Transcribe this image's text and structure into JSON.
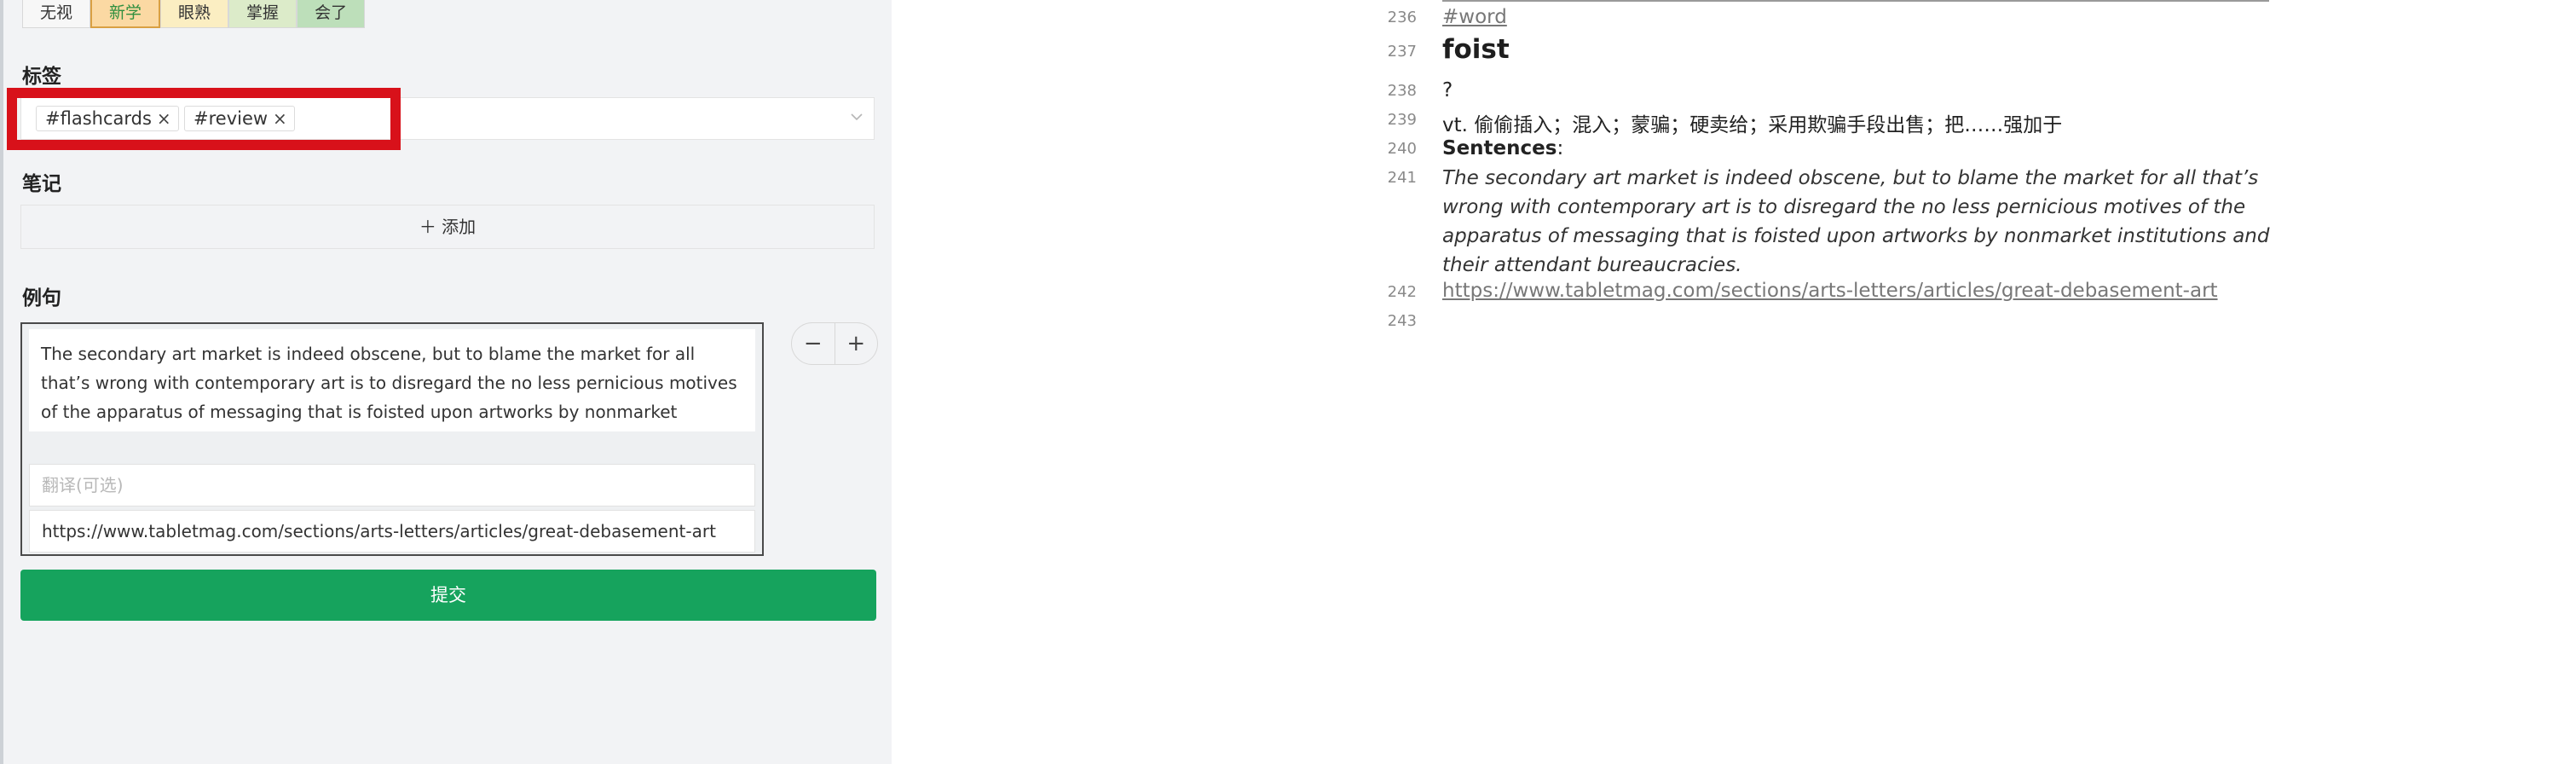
{
  "status_buttons": [
    {
      "label": "无视"
    },
    {
      "label": "新学"
    },
    {
      "label": "眼熟"
    },
    {
      "label": "掌握"
    },
    {
      "label": "会了"
    }
  ],
  "tags_section": {
    "label": "标签",
    "tags": [
      "#flashcards",
      "#review"
    ]
  },
  "notes_section": {
    "label": "笔记",
    "add_label": "添加"
  },
  "examples_section": {
    "label": "例句",
    "sentence": "The secondary art market is indeed obscene, but to blame the market for all that’s wrong with contemporary art is to disregard the no less pernicious motives of the apparatus of messaging that is foisted upon artworks by nonmarket institutions and their attendant bureaucracies.",
    "translation_placeholder": "翻译(可选)",
    "source": "https://www.tabletmag.com/sections/arts-letters/articles/great-debasement-art"
  },
  "submit_label": "提交",
  "editor": {
    "lines": [
      {
        "num": "236",
        "text": "#word"
      },
      {
        "num": "237",
        "text": "foist"
      },
      {
        "num": "238",
        "text": "?"
      },
      {
        "num": "239",
        "text": "vt. 偷偷插入；混入；蒙骗；硬卖给；采用欺骗手段出售；把……强加于"
      },
      {
        "num": "240",
        "text": "Sentences",
        "suffix": ":"
      },
      {
        "num": "241",
        "text": "The secondary art market is indeed obscene, but to blame the market for all that’s wrong with contemporary art is to disregard the no less pernicious motives of the apparatus of messaging that is foisted upon artworks by nonmarket institutions and their attendant bureaucracies."
      },
      {
        "num": "242",
        "text": "https://www.tabletmag.com/sections/arts-letters/articles/great-debasement-art"
      },
      {
        "num": "243",
        "text": ""
      }
    ]
  },
  "colors": {
    "submit": "#16a35d",
    "highlight": "#d8111a",
    "status_new": "#fbd9a3"
  }
}
